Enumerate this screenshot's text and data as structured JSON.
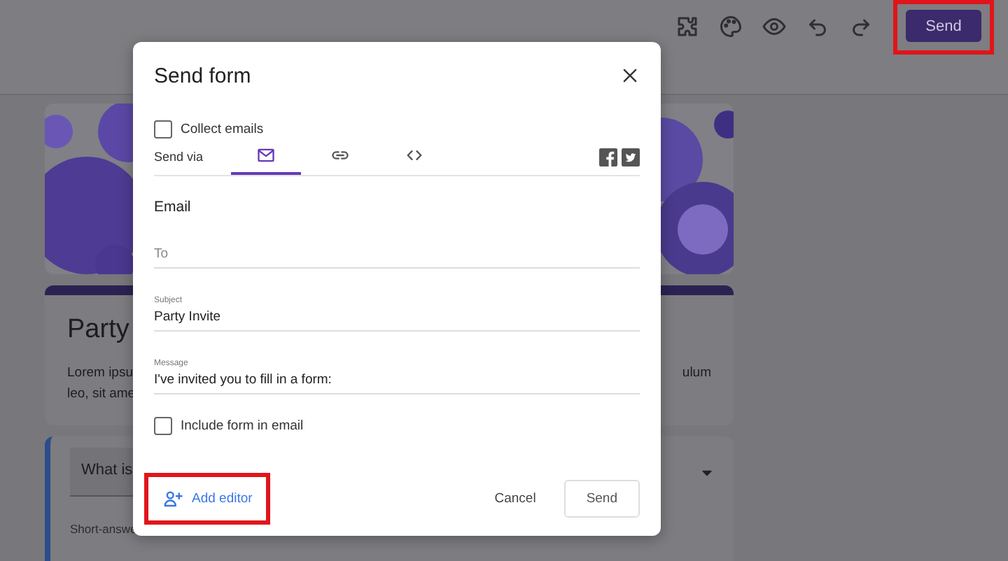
{
  "toolbar": {
    "send_button": {
      "label": "Send",
      "highlighted": true
    }
  },
  "form": {
    "title": "Party",
    "description": [
      {
        "left": "Lorem ipsu",
        "right": "ulum"
      },
      {
        "left": "leo, sit ame"
      }
    ],
    "question": {
      "title": "What is",
      "answer_hint": "Short-answe"
    }
  },
  "dialog": {
    "title": "Send form",
    "collect_emails": {
      "label": "Collect emails",
      "checked": false
    },
    "send_via_label": "Send via",
    "tabs": [
      {
        "kind": "email",
        "selected": true
      },
      {
        "kind": "link",
        "selected": false
      },
      {
        "kind": "embed",
        "selected": false
      }
    ],
    "section_title": "Email",
    "fields": [
      {
        "placeholder": "To"
      },
      {
        "label": "Subject",
        "value": "Party Invite"
      },
      {
        "label": "Message",
        "value": "I've invited you to fill in a form:"
      }
    ],
    "include_form": {
      "label": "Include form in email",
      "checked": false
    },
    "add_editor": {
      "label": "Add editor",
      "highlighted": true
    },
    "buttons": [
      {
        "kind": "text",
        "label": "Cancel"
      },
      {
        "kind": "outlined",
        "label": "Send"
      }
    ]
  }
}
